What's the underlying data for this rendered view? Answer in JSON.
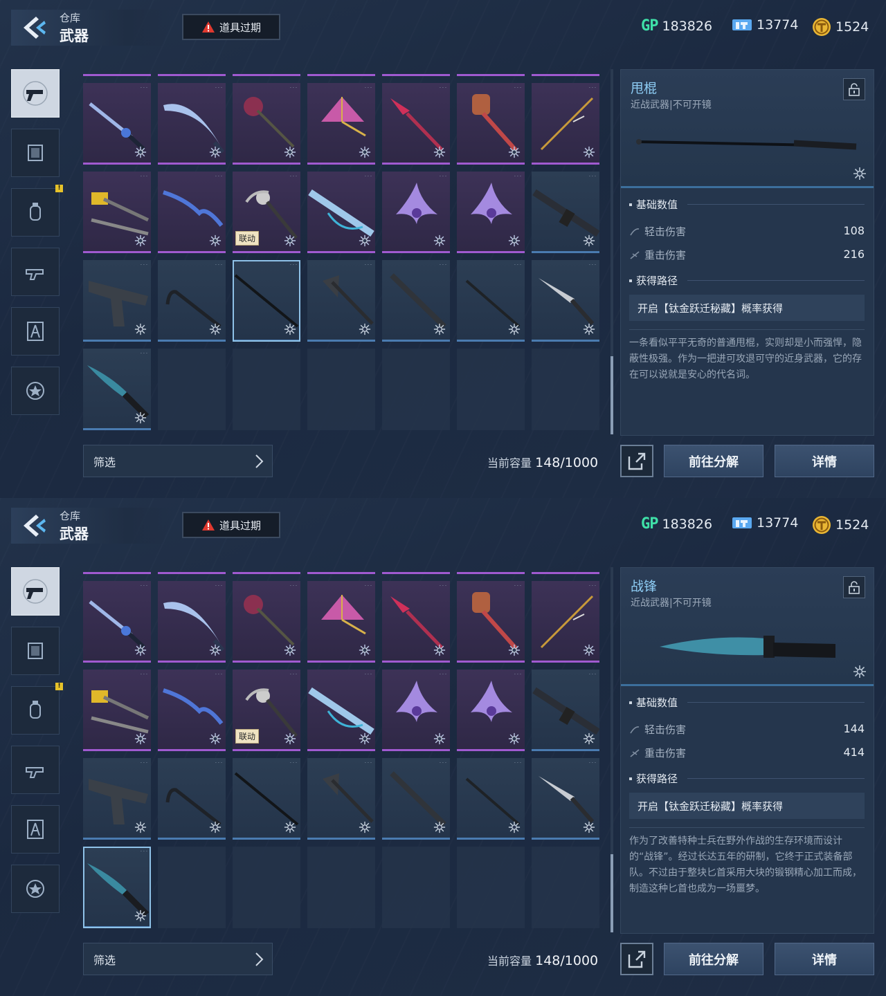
{
  "header": {
    "subtitle": "仓库",
    "title": "武器",
    "alert_label": "道具过期"
  },
  "currencies": [
    {
      "icon": "gp-icon",
      "label": "GP",
      "value": "183826"
    },
    {
      "icon": "ticket-icon",
      "value": "13774"
    },
    {
      "icon": "gold-coin-icon",
      "value": "1524"
    }
  ],
  "sidebar": [
    {
      "icon": "pistol-icon",
      "active": true,
      "badge": ""
    },
    {
      "icon": "frame-icon",
      "active": false,
      "badge": ""
    },
    {
      "icon": "grenade-icon",
      "active": false,
      "badge": "!"
    },
    {
      "icon": "weapon-part-icon",
      "active": false,
      "badge": ""
    },
    {
      "icon": "character-icon",
      "active": false,
      "badge": ""
    },
    {
      "icon": "star-badge-icon",
      "active": false,
      "badge": ""
    }
  ],
  "grid": {
    "collab_tag": "联动",
    "rows": [
      [
        "purple",
        "purple",
        "purple",
        "purple",
        "purple",
        "purple",
        "purple"
      ],
      [
        "purple",
        "purple",
        "purple",
        "purple",
        "purple",
        "purple",
        "blue"
      ],
      [
        "blue",
        "blue",
        "blue",
        "blue",
        "blue",
        "blue",
        "blue"
      ],
      [
        "blue",
        "empty",
        "empty",
        "empty",
        "empty",
        "empty",
        "empty"
      ]
    ]
  },
  "filter": {
    "label": "筛选"
  },
  "capacity": {
    "label": "当前容量",
    "current": "148",
    "max": "/1000"
  },
  "buttons": {
    "decompose": "前往分解",
    "details": "详情"
  },
  "panels": [
    {
      "selected_cell": "r2c2",
      "name": "甩棍",
      "type": "近战武器|不可开镜",
      "section_stats": "基础数值",
      "light_label": "轻击伤害",
      "light_value": "108",
      "heavy_label": "重击伤害",
      "heavy_value": "216",
      "section_source": "获得路径",
      "source": "开启【钛金跃迁秘藏】概率获得",
      "description": "一条看似平平无奇的普通甩棍，实则却是小而强悍，隐蔽性极强。作为一把进可攻退可守的近身武器，它的存在可以说就是安心的代名词。"
    },
    {
      "selected_cell": "r3c0",
      "name": "战锋",
      "type": "近战武器|不可开镜",
      "section_stats": "基础数值",
      "light_label": "轻击伤害",
      "light_value": "144",
      "heavy_label": "重击伤害",
      "heavy_value": "414",
      "section_source": "获得路径",
      "source": "开启【钛金跃迁秘藏】概率获得",
      "description": "作为了改善特种士兵在野外作战的生存环境而设计的“战锋”。经过长达五年的研制，它终于正式装备部队。不过由于整块匕首采用大块的锻钢精心加工而成，制造这种匕首也成为一场噩梦。"
    }
  ],
  "colors": {
    "rare_purple": "#a05ad0",
    "rare_blue": "#4a7bb0",
    "accent_name": "#8ecdf5"
  }
}
